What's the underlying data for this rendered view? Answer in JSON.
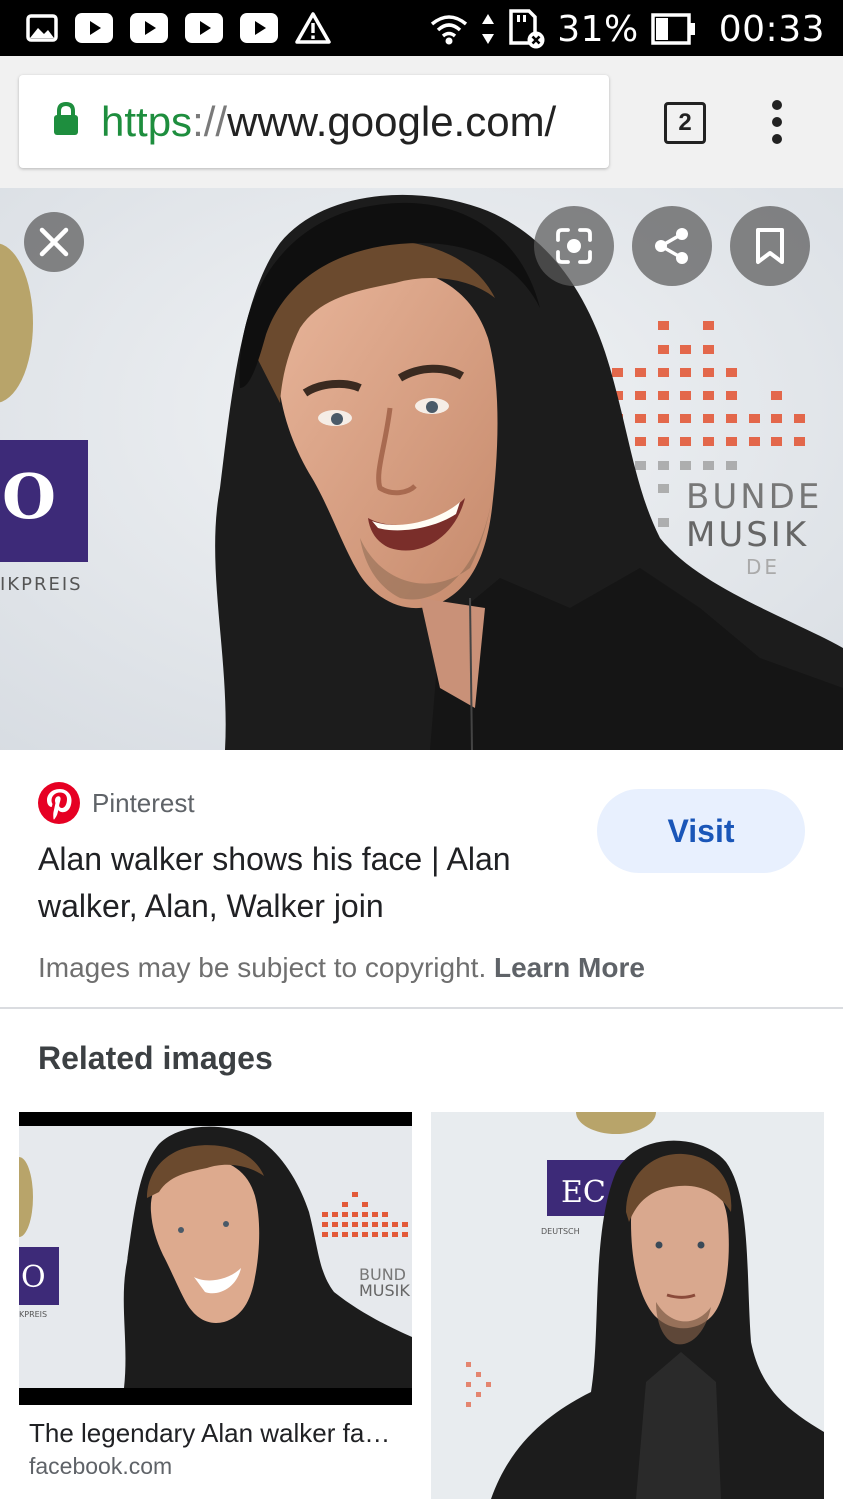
{
  "status_bar": {
    "battery_percent": "31%",
    "time": "00:33",
    "notification_icons": [
      "image-icon",
      "youtube-icon",
      "youtube-icon",
      "youtube-icon",
      "youtube-icon",
      "warning-icon"
    ],
    "system_icons": [
      "wifi-icon",
      "data-arrows-icon",
      "sd-card-icon",
      "battery-icon"
    ]
  },
  "browser": {
    "url_scheme": "https",
    "url_separator": "://",
    "url_host": "www.google.com/",
    "tab_count": "2"
  },
  "hero": {
    "background_banner_text": [
      "BUNDE",
      "MUSIK",
      "DE",
      "IKPREIS",
      "O"
    ],
    "buttons": [
      "close-icon",
      "lens-icon",
      "share-icon",
      "bookmark-icon"
    ]
  },
  "result": {
    "source": "Pinterest",
    "title": "Alan walker shows his face | Alan walker, Alan, Walker join",
    "visit_label": "Visit",
    "copyright_text": "Images may be subject to copyright.",
    "learn_more": "Learn More"
  },
  "related": {
    "heading": "Related images",
    "items": [
      {
        "title": "The legendary Alan walker fa…",
        "domain": "facebook.com",
        "image_text": [
          "BUND",
          "MUSIK",
          "O",
          "KPREIS"
        ]
      },
      {
        "image_text": [
          "EC",
          "DEUTSCH"
        ]
      }
    ]
  },
  "colors": {
    "accent_green": "#1e8e3e",
    "visit_bg": "#e8f0fe",
    "visit_text": "#1a56b8",
    "pinterest_red": "#e60023"
  }
}
